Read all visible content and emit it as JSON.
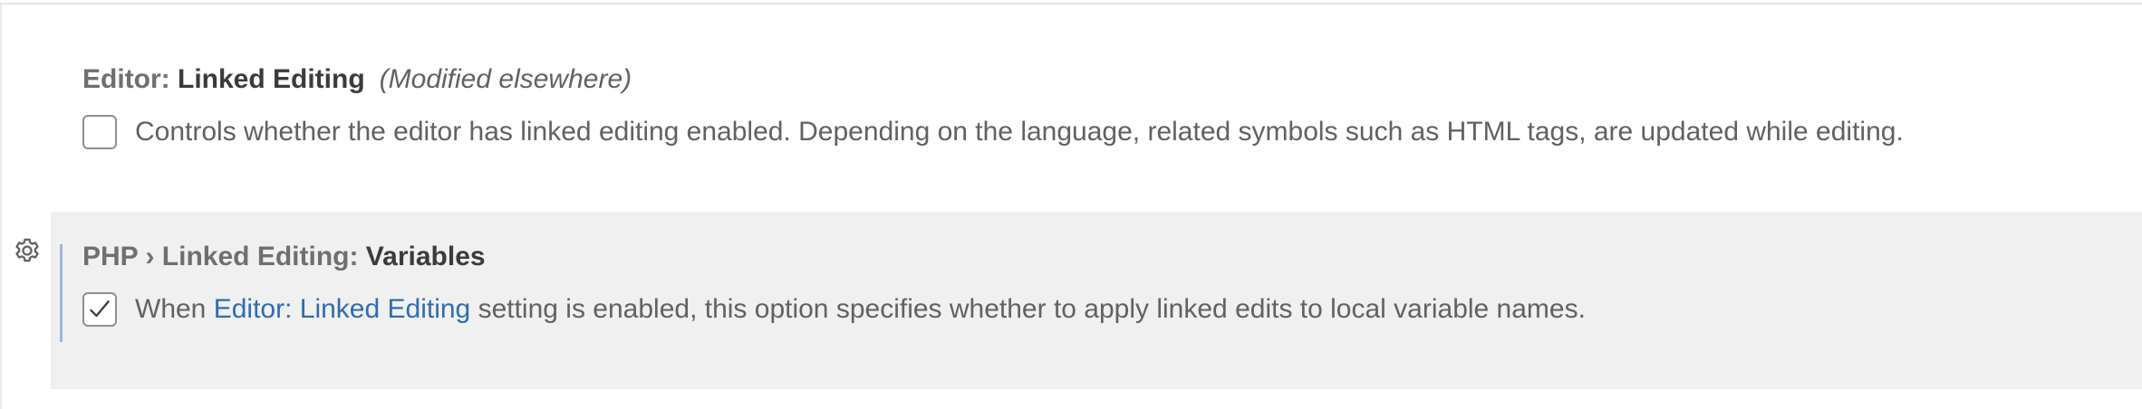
{
  "settings": [
    {
      "category": "Editor: ",
      "key": "Linked Editing",
      "modified_note": "(Modified elsewhere)",
      "checked": false,
      "description": "Controls whether the editor has linked editing enabled. Depending on the language, related symbols such as HTML tags, are updated while editing."
    },
    {
      "category": "PHP › Linked Editing: ",
      "key": "Variables",
      "checked": true,
      "description_prefix": "When ",
      "description_link": "Editor: Linked Editing",
      "description_suffix": " setting is enabled, this option specifies whether to apply linked edits to local variable names."
    }
  ],
  "icons": {
    "gear": "gear-icon",
    "check": "check-icon"
  },
  "colors": {
    "link": "#2f6dae",
    "focused_background": "#f0f0f0",
    "focus_indicator": "#9ab6dc"
  }
}
